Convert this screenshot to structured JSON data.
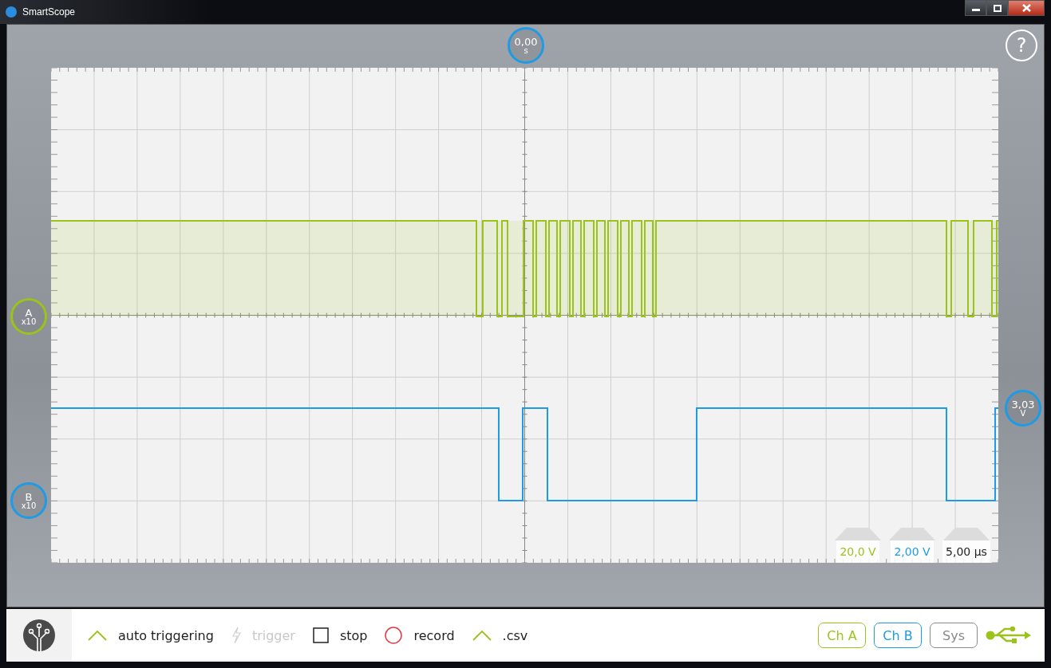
{
  "window": {
    "title": "SmartScope"
  },
  "time_marker": {
    "value": "0,00",
    "unit": "s"
  },
  "help_button": {
    "label": "?"
  },
  "channel_markers": [
    {
      "label": "A",
      "scale": "x10",
      "color": "#9bc31c"
    },
    {
      "label": "B",
      "scale": "x10",
      "color": "#1e9be6"
    }
  ],
  "trigger_marker": {
    "value": "3,03",
    "unit": "V"
  },
  "scale_readouts": [
    {
      "text": "20,0 V",
      "color": "#9bc31c"
    },
    {
      "text": "2,00 V",
      "color": "#1e9be6"
    },
    {
      "text": "5,00 µs",
      "color": "#222222"
    }
  ],
  "toolbar": {
    "items": [
      {
        "kind": "caret",
        "label": "auto triggering",
        "disabled": false
      },
      {
        "kind": "bolt",
        "label": "trigger",
        "disabled": true
      },
      {
        "kind": "square",
        "label": "stop",
        "disabled": false
      },
      {
        "kind": "circle",
        "label": "record",
        "disabled": false
      },
      {
        "kind": "caret",
        "label": ".csv",
        "disabled": false
      }
    ]
  },
  "channel_buttons": [
    {
      "label": "Ch A",
      "color": "#9bc31c"
    },
    {
      "label": "Ch B",
      "color": "#1e9be6"
    },
    {
      "label": "Sys",
      "color": "#8a8a8a"
    }
  ]
}
